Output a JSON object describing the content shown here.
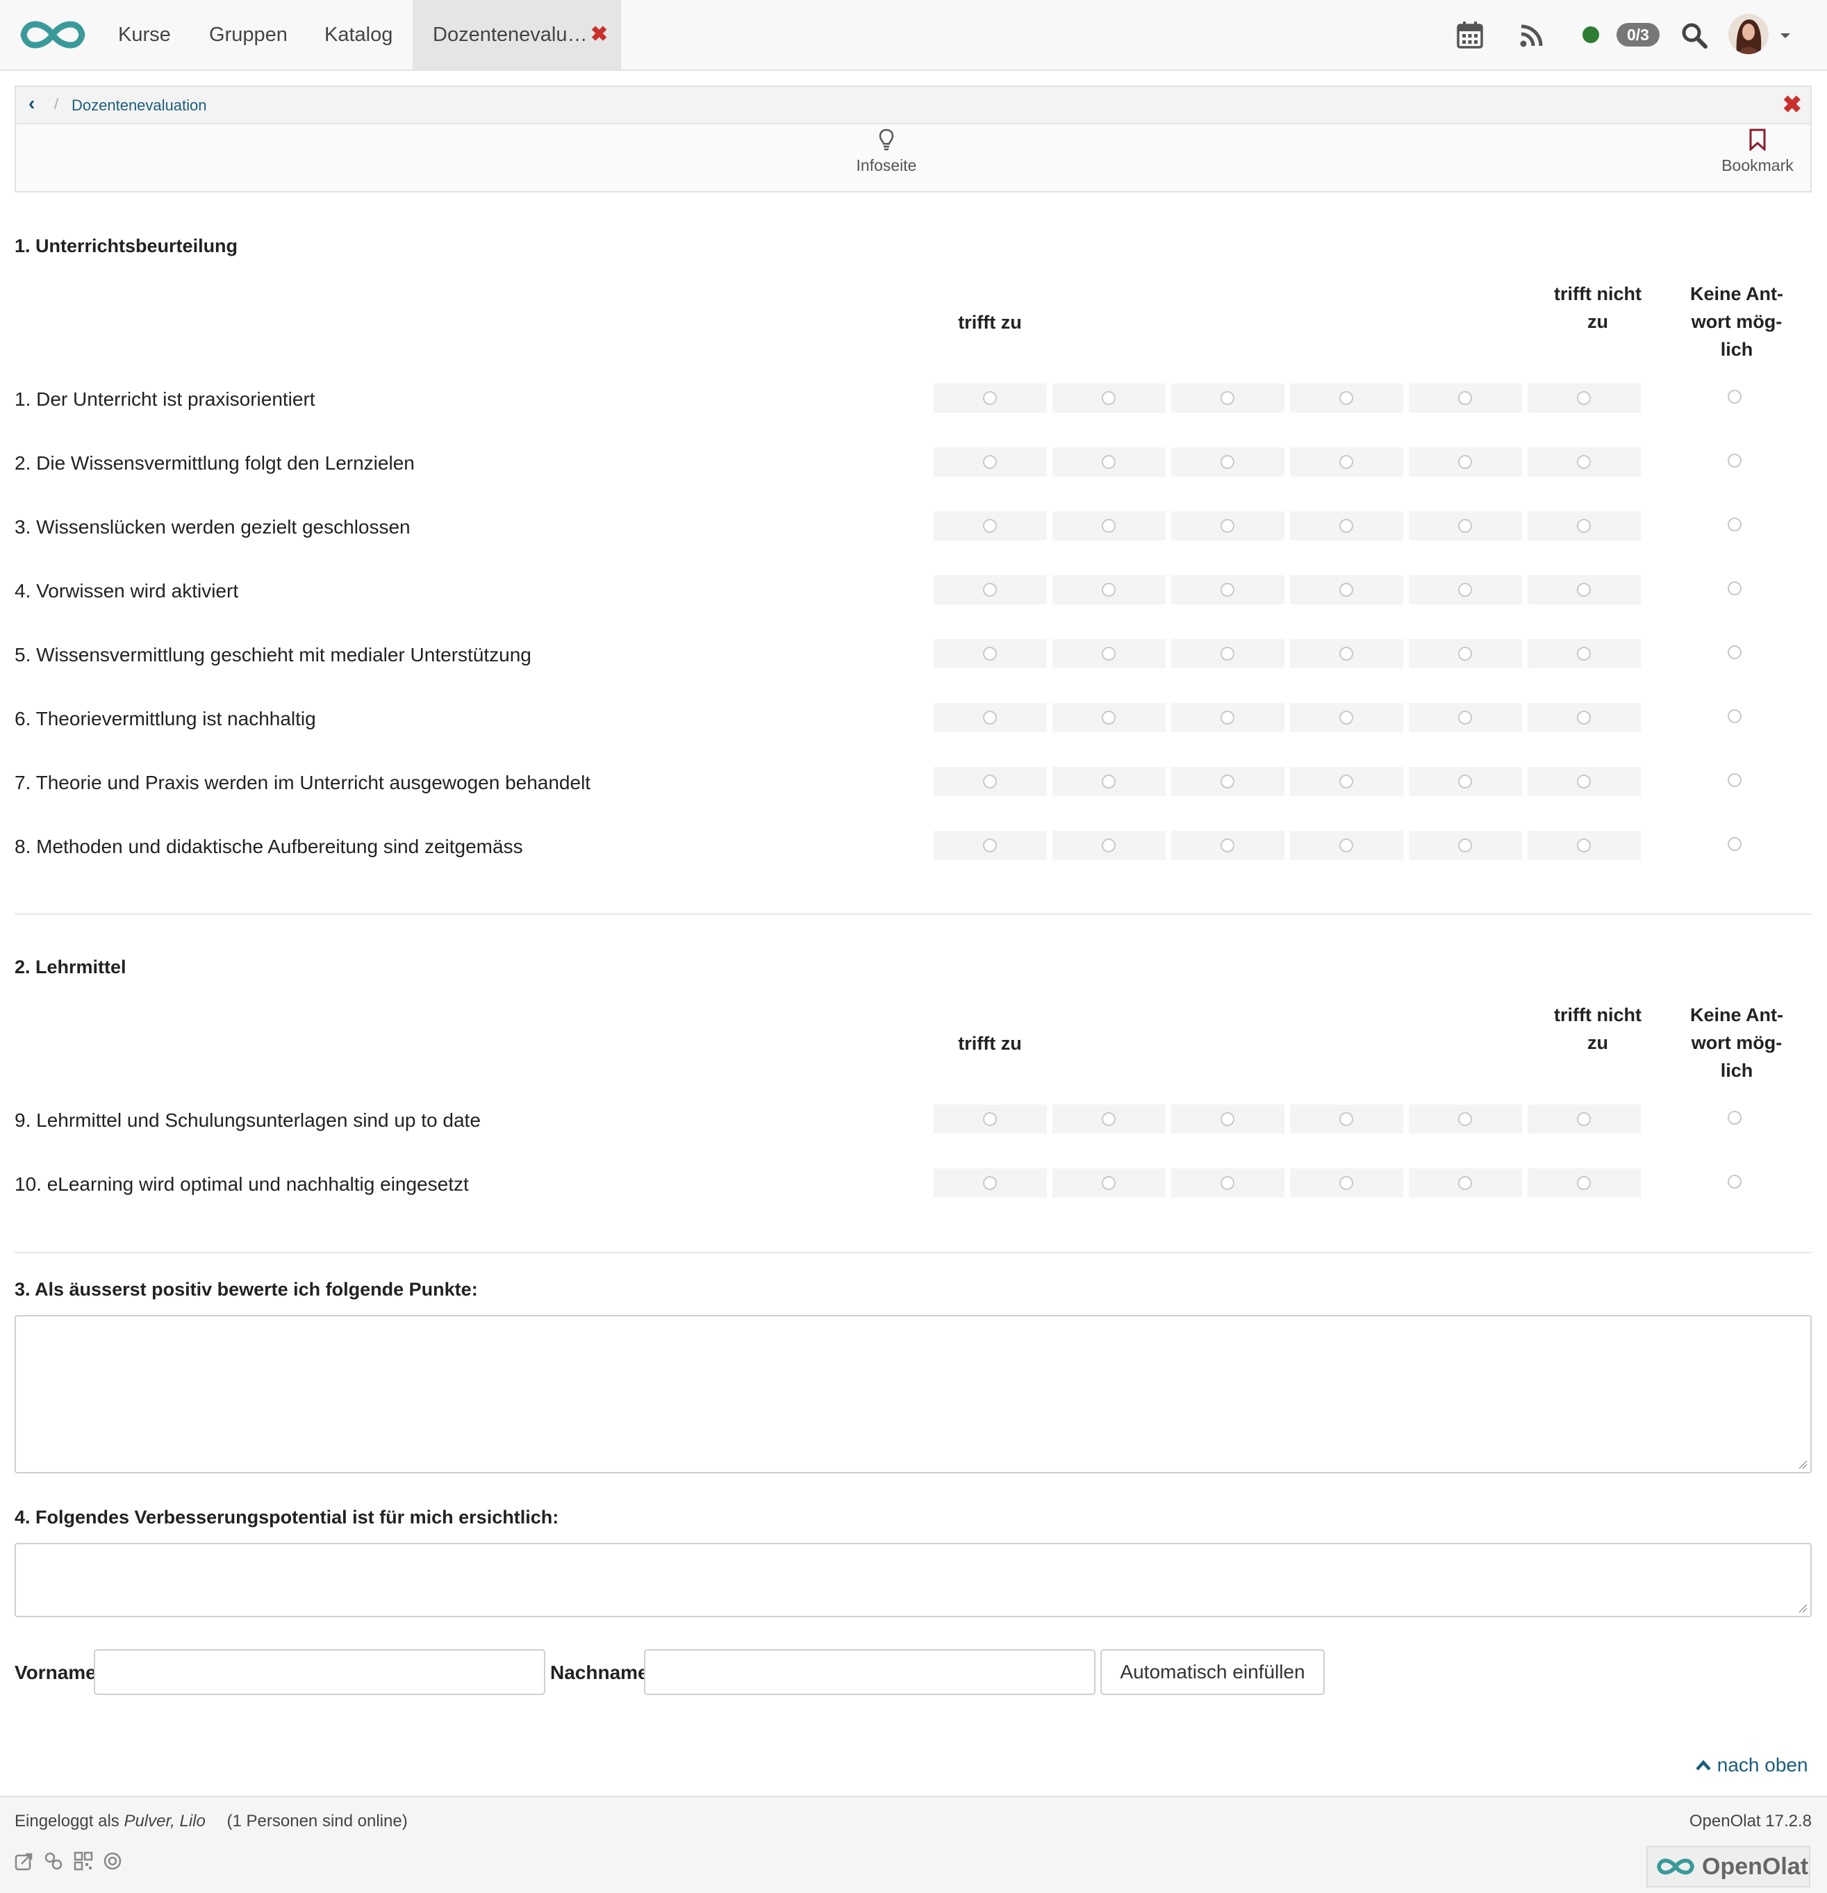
{
  "nav": {
    "tabs": [
      "Kurse",
      "Gruppen",
      "Katalog"
    ],
    "active_tab": "Dozentenevalu…",
    "badge": "0/3",
    "icons": [
      "calendar-icon",
      "rss-icon",
      "search-icon"
    ],
    "status_color": "#2e7d32"
  },
  "breadcrumb": {
    "current": "Dozentenevaluation",
    "separator": "/"
  },
  "toolbar": {
    "info_label": "Infoseite",
    "bookmark_label": "Bookmark"
  },
  "sections": [
    {
      "title": "1. Unterrichtsbeurteilung",
      "scale_left": "trifft zu",
      "scale_right": [
        "trifft nicht",
        "zu"
      ],
      "no_answer": [
        "Keine Ant-",
        "wort mög-",
        "lich"
      ],
      "questions": [
        "1. Der Unterricht ist praxisorientiert",
        "2. Die Wissensvermittlung folgt den Lernzielen",
        "3. Wissenslücken werden gezielt geschlossen",
        "4. Vorwissen wird aktiviert",
        "5. Wissensvermittlung geschieht mit medialer Unterstützung",
        "6. Theorievermittlung ist nachhaltig",
        "7. Theorie und Praxis werden im Unterricht ausgewogen behandelt",
        "8. Methoden und didaktische Aufbereitung sind zeitgemäss"
      ]
    },
    {
      "title": "2. Lehrmittel",
      "scale_left": "trifft zu",
      "scale_right": [
        "trifft nicht",
        "zu"
      ],
      "no_answer": [
        "Keine Ant-",
        "wort mög-",
        "lich"
      ],
      "questions": [
        "9. Lehrmittel und Schulungsunterlagen sind up to date",
        "10. eLearning wird optimal und nachhaltig eingesetzt"
      ]
    }
  ],
  "scale_points": 6,
  "open_questions": [
    "3. Als äusserst positiv bewerte ich folgende Punkte:",
    "4. Folgendes Verbesserungspotential ist für mich ersichtlich:"
  ],
  "form": {
    "firstname_label": "Vorname",
    "lastname_label": "Nachname",
    "firstname_value": "",
    "lastname_value": "",
    "autofill_button": "Automatisch einfüllen"
  },
  "to_top": "nach oben",
  "footer": {
    "logged_in_prefix": "Eingeloggt als",
    "user": "Pulver, Lilo",
    "online": "(1 Personen sind online)",
    "version": "OpenOlat 17.2.8",
    "brand": "OpenOlat",
    "icons": [
      "share-icon",
      "link-icon",
      "qr-code-icon",
      "target-icon"
    ]
  }
}
